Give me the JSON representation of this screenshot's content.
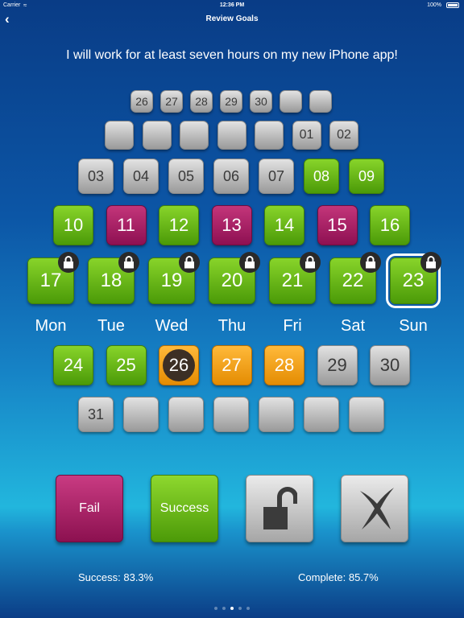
{
  "status_bar": {
    "carrier": "Carrier",
    "time": "12:36 PM",
    "battery": "100%"
  },
  "nav": {
    "back": "‹",
    "title": "Review Goals"
  },
  "goal_text": "I will work for at least seven hours on my new iPhone app!",
  "rows": [
    [
      "26",
      "27",
      "28",
      "29",
      "30",
      "",
      ""
    ],
    [
      "",
      "",
      "",
      "",
      "",
      "01",
      "02"
    ],
    [
      "03",
      "04",
      "05",
      "06",
      "07",
      "08",
      "09"
    ],
    [
      "10",
      "11",
      "12",
      "13",
      "14",
      "15",
      "16"
    ],
    [
      "17",
      "18",
      "19",
      "20",
      "21",
      "22",
      "23"
    ],
    [
      "24",
      "25",
      "26",
      "27",
      "28",
      "29",
      "30"
    ],
    [
      "31",
      "",
      "",
      "",
      "",
      "",
      ""
    ]
  ],
  "weekdays": [
    "Mon",
    "Tue",
    "Wed",
    "Thu",
    "Fri",
    "Sat",
    "Sun"
  ],
  "buttons": {
    "fail": "Fail",
    "success": "Success"
  },
  "stats": {
    "success": "Success: 83.3%",
    "complete": "Complete: 85.7%"
  },
  "page_indicator": {
    "count": 5,
    "active": 3
  }
}
